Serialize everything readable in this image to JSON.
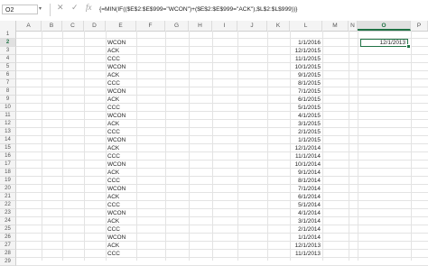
{
  "name_box": "O2",
  "formula_icons": {
    "cancel": "✕",
    "enter": "✓",
    "fx": "fx"
  },
  "formula": "{=MIN(IF(($E$2:$E$999=\"WCON\")+($E$2:$E$999=\"ACK\"),$L$2:$L$999))}",
  "columns": [
    "A",
    "B",
    "C",
    "D",
    "E",
    "F",
    "G",
    "H",
    "I",
    "J",
    "K",
    "L",
    "M",
    "N",
    "O",
    "P"
  ],
  "selected_column": "O",
  "selected_row": "2",
  "active_cell_value": "12/1/2013",
  "rows": [
    {
      "n": "1",
      "e": "",
      "l": ""
    },
    {
      "n": "2",
      "e": "WCON",
      "l": "1/1/2016"
    },
    {
      "n": "3",
      "e": "ACK",
      "l": "12/1/2015"
    },
    {
      "n": "4",
      "e": "CCC",
      "l": "11/1/2015"
    },
    {
      "n": "5",
      "e": "WCON",
      "l": "10/1/2015"
    },
    {
      "n": "6",
      "e": "ACK",
      "l": "9/1/2015"
    },
    {
      "n": "7",
      "e": "CCC",
      "l": "8/1/2015"
    },
    {
      "n": "8",
      "e": "WCON",
      "l": "7/1/2015"
    },
    {
      "n": "9",
      "e": "ACK",
      "l": "6/1/2015"
    },
    {
      "n": "10",
      "e": "CCC",
      "l": "5/1/2015"
    },
    {
      "n": "11",
      "e": "WCON",
      "l": "4/1/2015"
    },
    {
      "n": "12",
      "e": "ACK",
      "l": "3/1/2015"
    },
    {
      "n": "13",
      "e": "CCC",
      "l": "2/1/2015"
    },
    {
      "n": "14",
      "e": "WCON",
      "l": "1/1/2015"
    },
    {
      "n": "15",
      "e": "ACK",
      "l": "12/1/2014"
    },
    {
      "n": "16",
      "e": "CCC",
      "l": "11/1/2014"
    },
    {
      "n": "17",
      "e": "WCON",
      "l": "10/1/2014"
    },
    {
      "n": "18",
      "e": "ACK",
      "l": "9/1/2014"
    },
    {
      "n": "19",
      "e": "CCC",
      "l": "8/1/2014"
    },
    {
      "n": "20",
      "e": "WCON",
      "l": "7/1/2014"
    },
    {
      "n": "21",
      "e": "ACK",
      "l": "6/1/2014"
    },
    {
      "n": "22",
      "e": "CCC",
      "l": "5/1/2014"
    },
    {
      "n": "23",
      "e": "WCON",
      "l": "4/1/2014"
    },
    {
      "n": "24",
      "e": "ACK",
      "l": "3/1/2014"
    },
    {
      "n": "25",
      "e": "CCC",
      "l": "2/1/2014"
    },
    {
      "n": "26",
      "e": "WCON",
      "l": "1/1/2014"
    },
    {
      "n": "27",
      "e": "ACK",
      "l": "12/1/2013"
    },
    {
      "n": "28",
      "e": "CCC",
      "l": "11/1/2013"
    },
    {
      "n": "29",
      "e": "",
      "l": ""
    }
  ],
  "accent_color": "#217346"
}
